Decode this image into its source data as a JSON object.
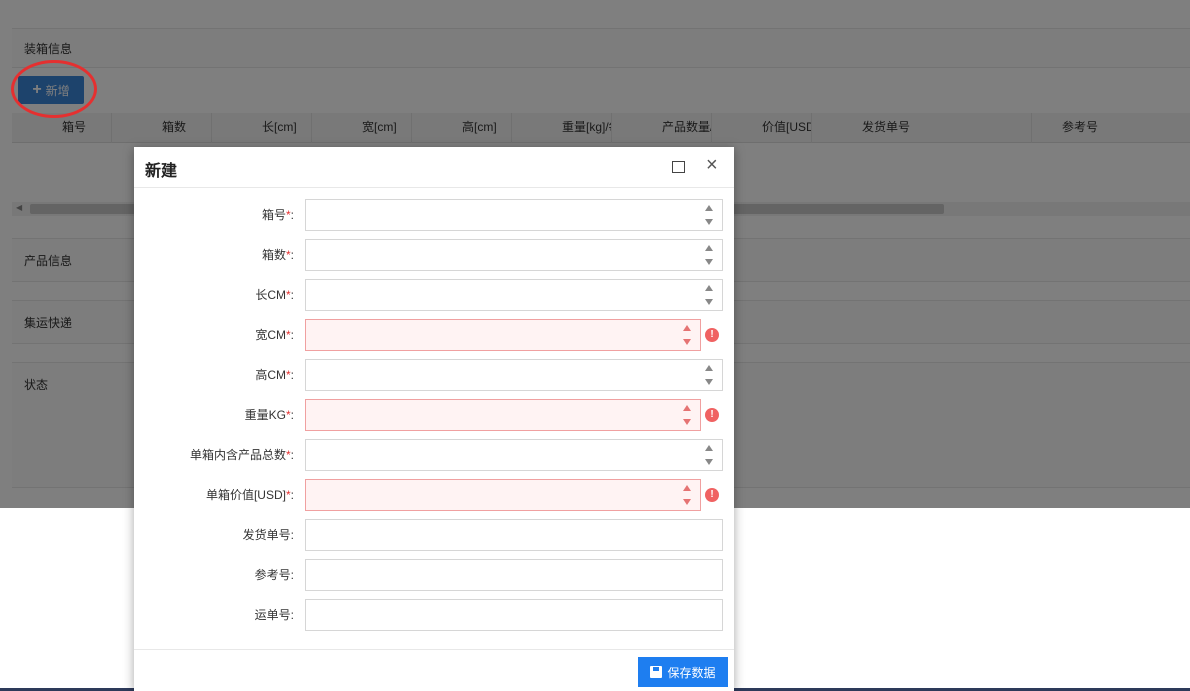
{
  "background": {
    "panels": {
      "packing_info": "装箱信息",
      "product_info": "产品信息",
      "consolidation": "集运快递",
      "status": "状态"
    },
    "add_button_label": "新增",
    "grid_columns": [
      "箱号",
      "箱数",
      "长[cm]",
      "宽[cm]",
      "高[cm]",
      "重量[kg]/每箱",
      "产品数量/每箱",
      "价值[USD]/...",
      "发货单号",
      "参考号"
    ]
  },
  "dialog": {
    "title": "新建",
    "save_label": "保存数据",
    "required_mark": "*",
    "colon": ":",
    "fields": [
      {
        "label": "箱号",
        "required": true,
        "numeric": true,
        "invalid": false,
        "value": ""
      },
      {
        "label": "箱数",
        "required": true,
        "numeric": true,
        "invalid": false,
        "value": ""
      },
      {
        "label": "长CM",
        "required": true,
        "numeric": true,
        "invalid": false,
        "value": ""
      },
      {
        "label": "宽CM",
        "required": true,
        "numeric": true,
        "invalid": true,
        "value": ""
      },
      {
        "label": "高CM",
        "required": true,
        "numeric": true,
        "invalid": false,
        "value": ""
      },
      {
        "label": "重量KG",
        "required": true,
        "numeric": true,
        "invalid": true,
        "value": ""
      },
      {
        "label": "单箱内含产品总数",
        "required": true,
        "numeric": true,
        "invalid": false,
        "value": ""
      },
      {
        "label": "单箱价值[USD]",
        "required": true,
        "numeric": true,
        "invalid": true,
        "value": ""
      },
      {
        "label": "发货单号",
        "required": false,
        "numeric": false,
        "invalid": false,
        "value": ""
      },
      {
        "label": "参考号",
        "required": false,
        "numeric": false,
        "invalid": false,
        "value": ""
      },
      {
        "label": "运单号",
        "required": false,
        "numeric": false,
        "invalid": false,
        "value": ""
      }
    ]
  },
  "colors": {
    "primary": "#1e7ef0",
    "error": "#f06262",
    "annotation": "#e53030"
  }
}
